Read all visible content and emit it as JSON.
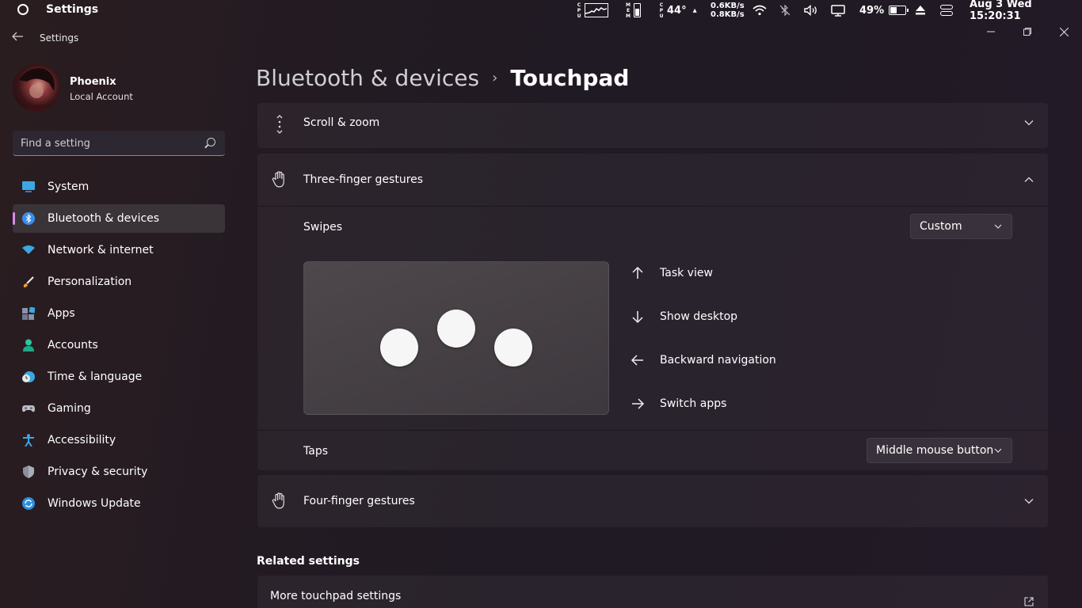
{
  "topbar": {
    "app_title": "Settings",
    "cpu_label_letters": [
      "C",
      "P",
      "U"
    ],
    "mem_label_letters": [
      "M",
      "E",
      "M"
    ],
    "temperature": "44°",
    "net_up": "0.6KB/s",
    "net_down": "0.8KB/s",
    "battery_percent": "49%",
    "datetime": "Aug 3 Wed 15:20:31"
  },
  "window": {
    "app_label": "Settings"
  },
  "user": {
    "name": "Phoenix",
    "account_type": "Local Account"
  },
  "search": {
    "placeholder": "Find a setting"
  },
  "sidebar": {
    "items": [
      {
        "label": "System",
        "icon": "system-icon",
        "active": false
      },
      {
        "label": "Bluetooth & devices",
        "icon": "bluetooth-icon",
        "active": true
      },
      {
        "label": "Network & internet",
        "icon": "wifi-icon",
        "active": false
      },
      {
        "label": "Personalization",
        "icon": "brush-icon",
        "active": false
      },
      {
        "label": "Apps",
        "icon": "apps-icon",
        "active": false
      },
      {
        "label": "Accounts",
        "icon": "accounts-icon",
        "active": false
      },
      {
        "label": "Time & language",
        "icon": "clock-globe-icon",
        "active": false
      },
      {
        "label": "Gaming",
        "icon": "gamepad-icon",
        "active": false
      },
      {
        "label": "Accessibility",
        "icon": "accessibility-icon",
        "active": false
      },
      {
        "label": "Privacy & security",
        "icon": "shield-icon",
        "active": false
      },
      {
        "label": "Windows Update",
        "icon": "update-icon",
        "active": false
      }
    ]
  },
  "breadcrumb": {
    "parent": "Bluetooth & devices",
    "separator": "›",
    "current": "Touchpad"
  },
  "sections": {
    "scroll_zoom": {
      "title": "Scroll & zoom",
      "expanded": false
    },
    "three_finger": {
      "title": "Three-finger gestures",
      "expanded": true,
      "swipes_label": "Swipes",
      "swipes_value": "Custom",
      "actions": [
        {
          "direction": "up",
          "label": "Task view"
        },
        {
          "direction": "down",
          "label": "Show desktop"
        },
        {
          "direction": "left",
          "label": "Backward navigation"
        },
        {
          "direction": "right",
          "label": "Switch apps"
        }
      ],
      "taps_label": "Taps",
      "taps_value": "Middle mouse button"
    },
    "four_finger": {
      "title": "Four-finger gestures",
      "expanded": false
    }
  },
  "related": {
    "heading": "Related settings",
    "items": [
      {
        "label": "More touchpad settings"
      }
    ]
  },
  "colors": {
    "accent": "#d88be6",
    "bluetooth_icon": "#3b8ee8"
  }
}
